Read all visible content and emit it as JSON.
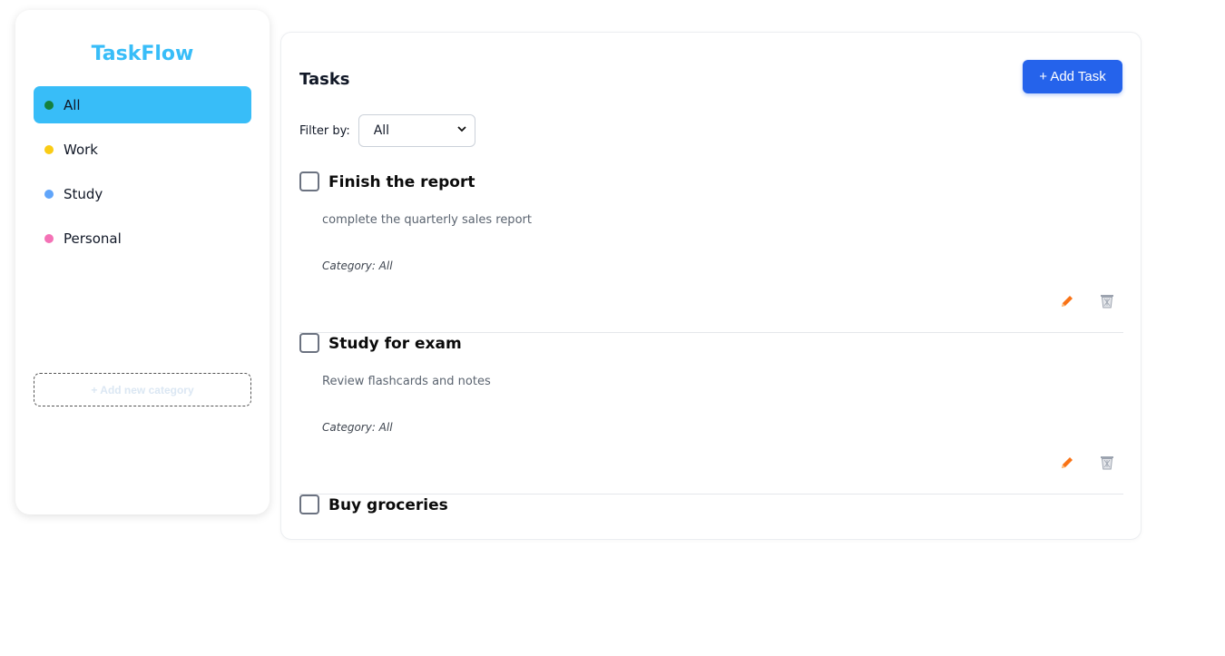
{
  "app": {
    "title": "TaskFlow"
  },
  "sidebar": {
    "categories": [
      {
        "label": "All",
        "color": "#15803d",
        "active": true
      },
      {
        "label": "Work",
        "color": "#facc15",
        "active": false
      },
      {
        "label": "Study",
        "color": "#60a5fa",
        "active": false
      },
      {
        "label": "Personal",
        "color": "#f472b6",
        "active": false
      }
    ],
    "add_category_label": "+ Add new category"
  },
  "main": {
    "title": "Tasks",
    "add_task_label": "+ Add Task",
    "filter": {
      "label": "Filter by:",
      "selected": "All"
    },
    "tasks": [
      {
        "title": "Finish the report",
        "description": "complete the quarterly sales report",
        "category": "Category: All"
      },
      {
        "title": "Study for exam",
        "description": "Review flashcards and notes",
        "category": "Category: All"
      },
      {
        "title": "Buy groceries",
        "description": "",
        "category": ""
      }
    ]
  },
  "icons": {
    "edit": "pencil-icon",
    "delete": "trash-icon",
    "dropdown": "chevron-down-icon"
  },
  "colors": {
    "accent": "#38bdf8",
    "primary_button": "#2563eb",
    "edit_icon": "#f97316",
    "delete_icon": "#9ca3af"
  }
}
